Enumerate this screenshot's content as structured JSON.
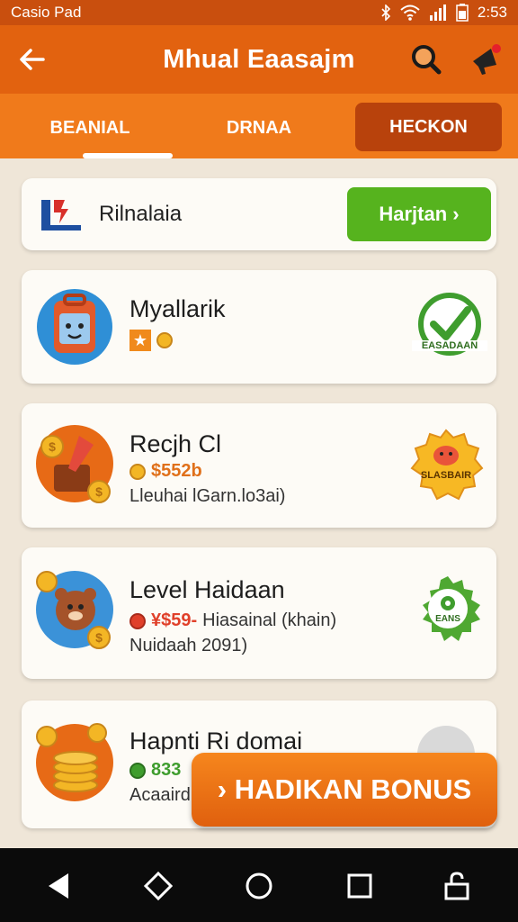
{
  "status_bar": {
    "carrier": "Casio Pad",
    "time": "2:53"
  },
  "app_bar": {
    "title": "Mhual Eaasajm"
  },
  "tabs": [
    {
      "label": "BEANIAL",
      "active": true
    },
    {
      "label": "DRNAA",
      "active": false
    },
    {
      "label": "HECKON",
      "active": false,
      "highlighted": true
    }
  ],
  "banner": {
    "text": "Rilnalaia",
    "button_label": "Harjtan",
    "button_arrow": "›"
  },
  "tasks": [
    {
      "title": "Myallarik",
      "reward": "",
      "subtitle": "",
      "badge_text": "EASADAAN",
      "badge": "check-badge-icon"
    },
    {
      "title": "Recjh Cl",
      "reward": "$552b",
      "subtitle": "Lleuhai lGarn.lo3ai)",
      "badge_text": "SLASBAIR",
      "badge": "pig-badge-icon"
    },
    {
      "title": "Level Haidaan",
      "reward": "¥$59-",
      "reward_note": "Hiasainal (khain)",
      "subtitle": "Nuidaah 2091)",
      "badge_text": "EANS",
      "badge": "gear-badge-icon"
    },
    {
      "title": "Hapnti Ri domai",
      "reward": "833",
      "subtitle": "Acaaird |"
    }
  ],
  "fab": {
    "label": "HADIKAN BONUS",
    "arrow": "›"
  },
  "colors": {
    "primary": "#e2620f",
    "accent": "#56b31e",
    "tab_bar": "#f07a1b"
  }
}
